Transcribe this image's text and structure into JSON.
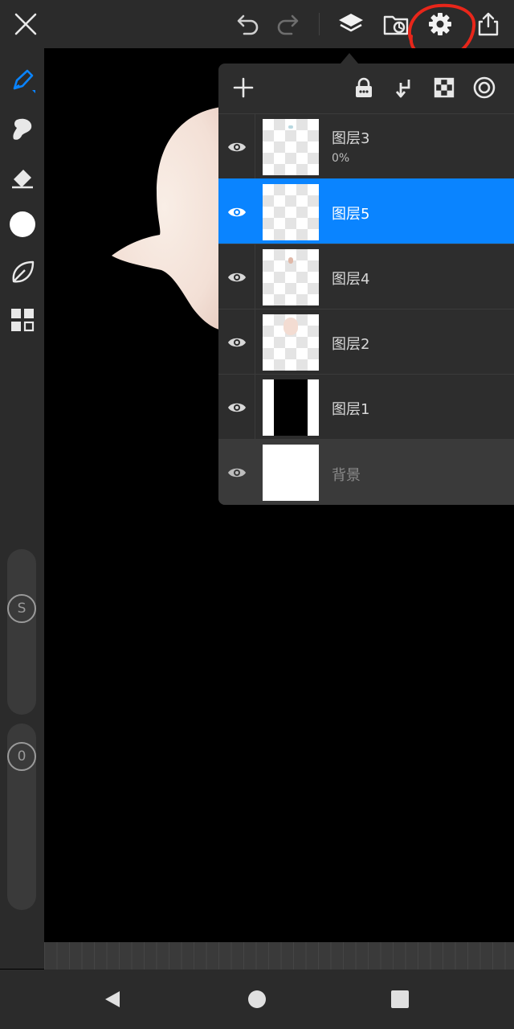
{
  "toolbar": {
    "icons": [
      "close-icon",
      "undo-icon",
      "redo-icon",
      "layers-icon",
      "gallery-icon",
      "settings-icon",
      "share-icon"
    ],
    "annotation_color": "#e8261a"
  },
  "left_toolbar": {
    "tools": [
      "brush-icon",
      "smudge-icon",
      "eraser-icon",
      "color-icon",
      "leaf-icon",
      "grid-icon"
    ],
    "active_tool_color": "#0a84ff",
    "size_slider_label": "S",
    "opacity_slider_label": "0"
  },
  "layers_panel": {
    "header_icons": [
      "add-layer-icon",
      "lock-icon",
      "merge-down-icon",
      "transparency-icon",
      "blend-mode-icon"
    ],
    "layers": [
      {
        "name": "图层3",
        "opacity": "0%",
        "visible": true,
        "selected": false
      },
      {
        "name": "图层5",
        "visible": true,
        "selected": true
      },
      {
        "name": "图层4",
        "visible": true,
        "selected": false
      },
      {
        "name": "图层2",
        "visible": true,
        "selected": false
      },
      {
        "name": "图层1",
        "visible": true,
        "selected": false
      },
      {
        "name": "背景",
        "visible": true,
        "selected": false,
        "background": true
      }
    ],
    "selected_color": "#0a84ff"
  },
  "navbar": {
    "icons": [
      "back-icon",
      "home-icon",
      "recents-icon"
    ]
  }
}
